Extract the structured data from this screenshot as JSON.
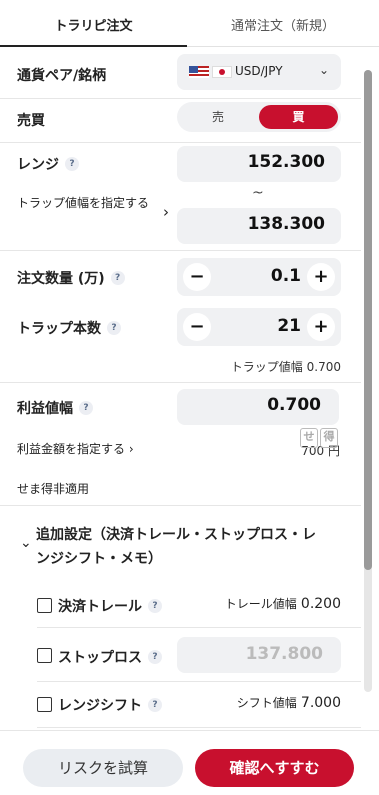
{
  "tabs": {
    "active": "トラリピ注文",
    "inactive": "通常注文（新規）"
  },
  "pair": {
    "label": "通貨ペア/銘柄",
    "value": "USD/JPY",
    "chevron": "⌄"
  },
  "side": {
    "label": "売買",
    "sell": "売",
    "buy": "買",
    "selected": "買"
  },
  "range": {
    "label": "レンジ",
    "specify_trap_width": "トラップ値幅を指定する",
    "specify_chevron": "›",
    "tilde": "~",
    "upper": "152.300",
    "lower": "138.300"
  },
  "quantity": {
    "label": "注文数量 (万)",
    "value": "0.1",
    "minus": "−",
    "plus": "+"
  },
  "traps": {
    "label": "トラップ本数",
    "value": "21",
    "minus": "−",
    "plus": "+",
    "width_label": "トラップ値幅",
    "width_value": "0.700"
  },
  "profit": {
    "label": "利益値幅",
    "value": "0.700",
    "specify_amount": "利益金額を指定する",
    "specify_chevron": "›",
    "amount": "700 円",
    "semaetoku": "せま得非適用",
    "stamp": [
      "せ",
      "得"
    ]
  },
  "advanced": {
    "chevron": "⌄",
    "title_line1": "追加設定（決済トレール・ストップロス・レ",
    "title_line2": "ンジシフト・メモ）"
  },
  "trail": {
    "label": "決済トレール",
    "width_label": "トレール値幅",
    "width_value": "0.200"
  },
  "stoploss": {
    "label": "ストップロス",
    "placeholder": "137.800"
  },
  "rangeshift": {
    "label": "レンジシフト",
    "width_label": "シフト値幅",
    "width_value": "7.000"
  },
  "help_icon": "?",
  "footer": {
    "risk": "リスクを試算",
    "confirm": "確認へすすむ"
  },
  "colors": {
    "accent": "#c8102e",
    "box": "#f0f1f3"
  }
}
